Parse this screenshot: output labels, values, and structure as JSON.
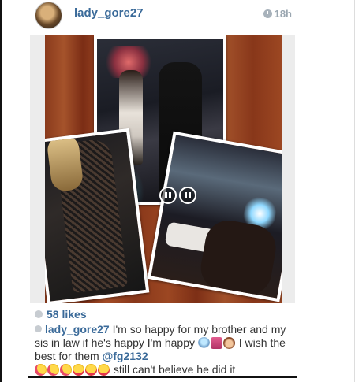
{
  "post": {
    "username": "lady_gore27",
    "time_ago": "18h"
  },
  "likes": {
    "count_label": "58 likes"
  },
  "caption": {
    "username": "lady_gore27",
    "text_part1": " I'm so happy for my brother and my sis in law if he's happy I'm happy ",
    "text_part2": " I wish the best for them ",
    "mention": "@fg2132",
    "text_part3": " still can't believe he did it"
  },
  "icons": {
    "clock": "clock-icon",
    "heart": "heart-icon",
    "comment": "comment-icon",
    "video_pause": "pause-icon"
  },
  "colors": {
    "link_blue": "#3a6a99",
    "timestamp_gray": "#9aa6b0"
  }
}
